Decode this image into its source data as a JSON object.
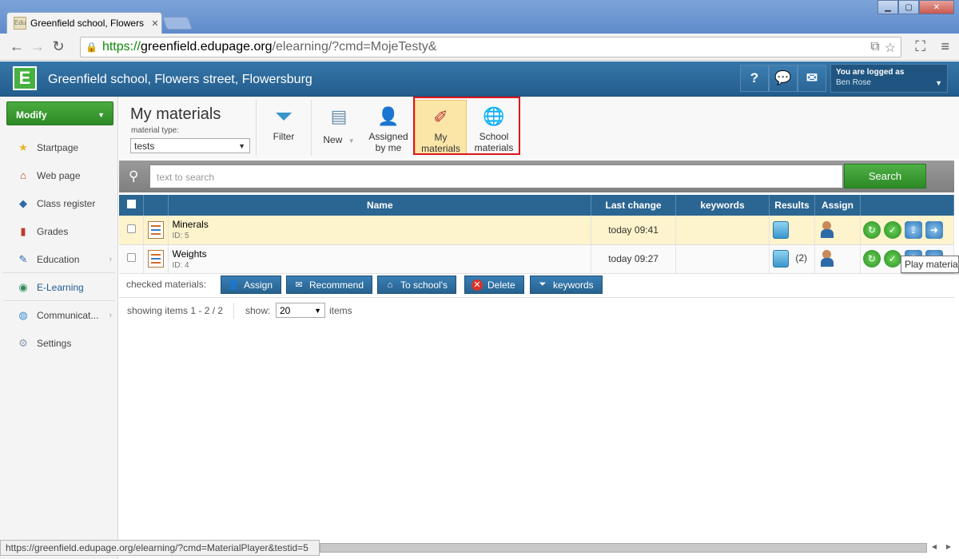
{
  "browser": {
    "tab_title": "Greenfield school, Flowers",
    "tab_favicon": "Edu",
    "url_https": "https://",
    "url_host": "greenfield.edupage.org",
    "url_path": "/elearning/?cmd=MojeTesty&",
    "status_url": "https://greenfield.edupage.org/elearning/?cmd=MaterialPlayer&testid=5"
  },
  "app": {
    "logo_letter": "E",
    "school_name": "Greenfield school, Flowers street, Flowersburg",
    "help_label": "?",
    "user_logged_label": "You are logged as",
    "user_name": "Ben Rose"
  },
  "sidebar": {
    "modify_label": "Modify",
    "items": [
      {
        "label": "Startpage",
        "icon": "star-icon"
      },
      {
        "label": "Web page",
        "icon": "webpage-icon"
      },
      {
        "label": "Class register",
        "icon": "class-register-icon"
      },
      {
        "label": "Grades",
        "icon": "grades-icon"
      },
      {
        "label": "Education",
        "icon": "education-icon"
      },
      {
        "label": "E-Learning",
        "icon": "elearning-icon"
      },
      {
        "label": "Communicat...",
        "icon": "communication-icon"
      },
      {
        "label": "Settings",
        "icon": "settings-icon"
      }
    ]
  },
  "ribbon": {
    "title": "My materials",
    "material_type_label": "material type:",
    "material_type_value": "tests",
    "filter_label": "Filter",
    "new_label": "New",
    "assigned_label_1": "Assigned",
    "assigned_label_2": "by me",
    "my_materials_label_1": "My",
    "my_materials_label_2": "materials",
    "school_materials_label_1": "School",
    "school_materials_label_2": "materials"
  },
  "search": {
    "placeholder": "text to search",
    "button_label": "Search"
  },
  "table": {
    "headers": {
      "name": "Name",
      "last_change": "Last change",
      "keywords": "keywords",
      "results": "Results",
      "assign": "Assign"
    },
    "rows": [
      {
        "name": "Minerals",
        "id": "ID: 5",
        "last_change": "today 09:41",
        "keywords": "",
        "results_count": ""
      },
      {
        "name": "Weights",
        "id": "ID: 4",
        "last_change": "today 09:27",
        "keywords": "",
        "results_count": "(2)"
      }
    ]
  },
  "bulk": {
    "label": "checked materials:",
    "assign": "Assign",
    "recommend": "Recommend",
    "to_schools": "To school's",
    "delete": "Delete",
    "keywords": "keywords"
  },
  "pager": {
    "showing": "showing items 1 - 2 / 2",
    "show_label": "show:",
    "show_value": "20",
    "items_label": "items"
  },
  "tooltip": "Play material",
  "colors": {
    "header_blue": "#2b6592",
    "green": "#3a9a31",
    "highlight_row": "#fdf3cc",
    "red_outline": "#e0151b"
  }
}
